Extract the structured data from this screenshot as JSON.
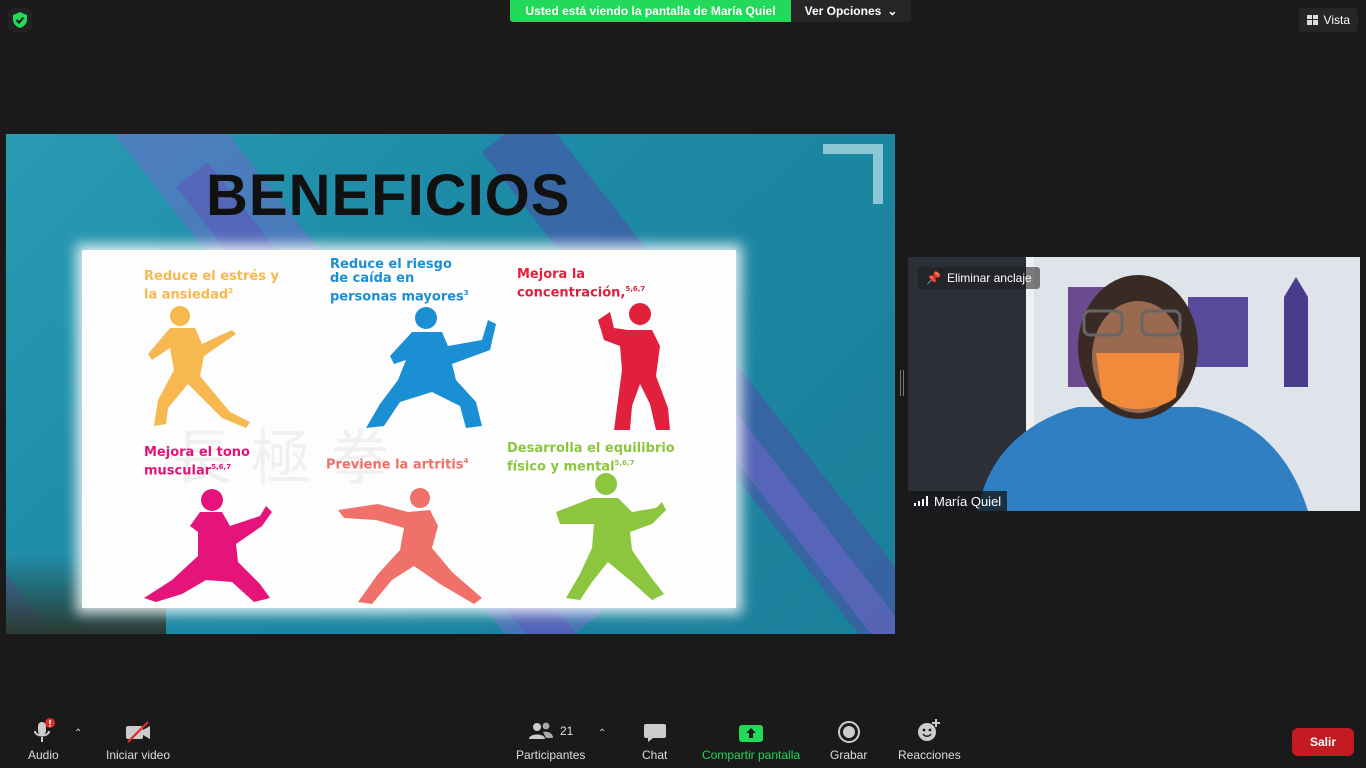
{
  "banner": {
    "viewing": "Usted está viendo la pantalla de María Quiel",
    "options": "Ver Opciones"
  },
  "view": {
    "label": "Vista"
  },
  "slide": {
    "title": "BENEFICIOS",
    "benefits": [
      {
        "text": "Reduce el estrés y la ansiedad",
        "sup": "2",
        "color": "#f7b850"
      },
      {
        "text": "Reduce el riesgo de caída en personas mayores",
        "sup": "3",
        "color": "#1b8fd4"
      },
      {
        "text": "Mejora la concentración,",
        "sup": "5,6,7",
        "color": "#e0203c"
      },
      {
        "text": "Mejora el tono muscular",
        "sup": "5,6,7",
        "color": "#e4147a"
      },
      {
        "text": "Previene la artritis",
        "sup": "4",
        "color": "#f0716a"
      },
      {
        "text": "Desarrolla el equilibrio físico y mental",
        "sup": "5,6,7",
        "color": "#8cc63f"
      }
    ]
  },
  "video": {
    "unpin": "Eliminar anclaje",
    "participant_name": "María Quiel"
  },
  "toolbar": {
    "audio": "Audio",
    "start_video": "Iniciar video",
    "participants": "Participantes",
    "participants_count": "21",
    "chat": "Chat",
    "share_screen": "Compartir pantalla",
    "record": "Grabar",
    "reactions": "Reacciones",
    "leave": "Salir"
  },
  "colors": {
    "accent_green": "#23d959",
    "leave_red": "#c31a24"
  }
}
